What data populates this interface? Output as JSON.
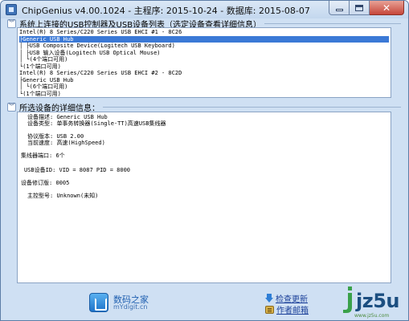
{
  "window": {
    "title": "ChipGenius v4.00.1024 - 主程序: 2015-10-24 - 数据库: 2015-08-07"
  },
  "device_list": {
    "header": "系统上连接的USB控制器及USB设备列表（选定设备查看详细信息）",
    "rows": [
      {
        "text": "Intel(R) 8 Series/C220 Series USB EHCI #1 - 8C26",
        "selected": false
      },
      {
        "text": "├Generic USB Hub",
        "selected": true
      },
      {
        "text": "│ ├USB Composite Device(Logitech USB Keyboard)",
        "selected": false
      },
      {
        "text": "│ ├USB 输入设备(Logitech USB Optical Mouse)",
        "selected": false
      },
      {
        "text": "│ └(4个端口可用)",
        "selected": false
      },
      {
        "text": "└(1个端口可用)",
        "selected": false
      },
      {
        "text": "Intel(R) 8 Series/C220 Series USB EHCI #2 - 8C2D",
        "selected": false
      },
      {
        "text": "├Generic USB Hub",
        "selected": false
      },
      {
        "text": "│ └(6个端口可用)",
        "selected": false
      },
      {
        "text": "└(1个端口可用)",
        "selected": false
      }
    ]
  },
  "details": {
    "header": "所选设备的详细信息：",
    "rows": [
      {
        "label": "设备描述:",
        "value": "Generic USB Hub"
      },
      {
        "label": "设备类型:",
        "value": "单事务转换器(Single-TT)高速USB集线器"
      },
      {
        "label": "协议版本:",
        "value": "USB 2.00"
      },
      {
        "label": "当前速度:",
        "value": "高速(HighSpeed)"
      },
      {
        "label": "集线器端口:",
        "value": "6个"
      },
      {
        "label": "USB设备ID:",
        "value": "VID = 8087 PID = 8000"
      },
      {
        "label": "设备修订版:",
        "value": "0005"
      },
      {
        "label": "主控型号:",
        "value": "Unknown(未知)"
      }
    ]
  },
  "footer": {
    "site_name": "数码之家",
    "site_url": "mYdigit.cn",
    "check_update": "检查更新",
    "author_email": "作者邮箱",
    "watermark_text": "jz5u",
    "watermark_sub": "www.jz5u.com"
  }
}
